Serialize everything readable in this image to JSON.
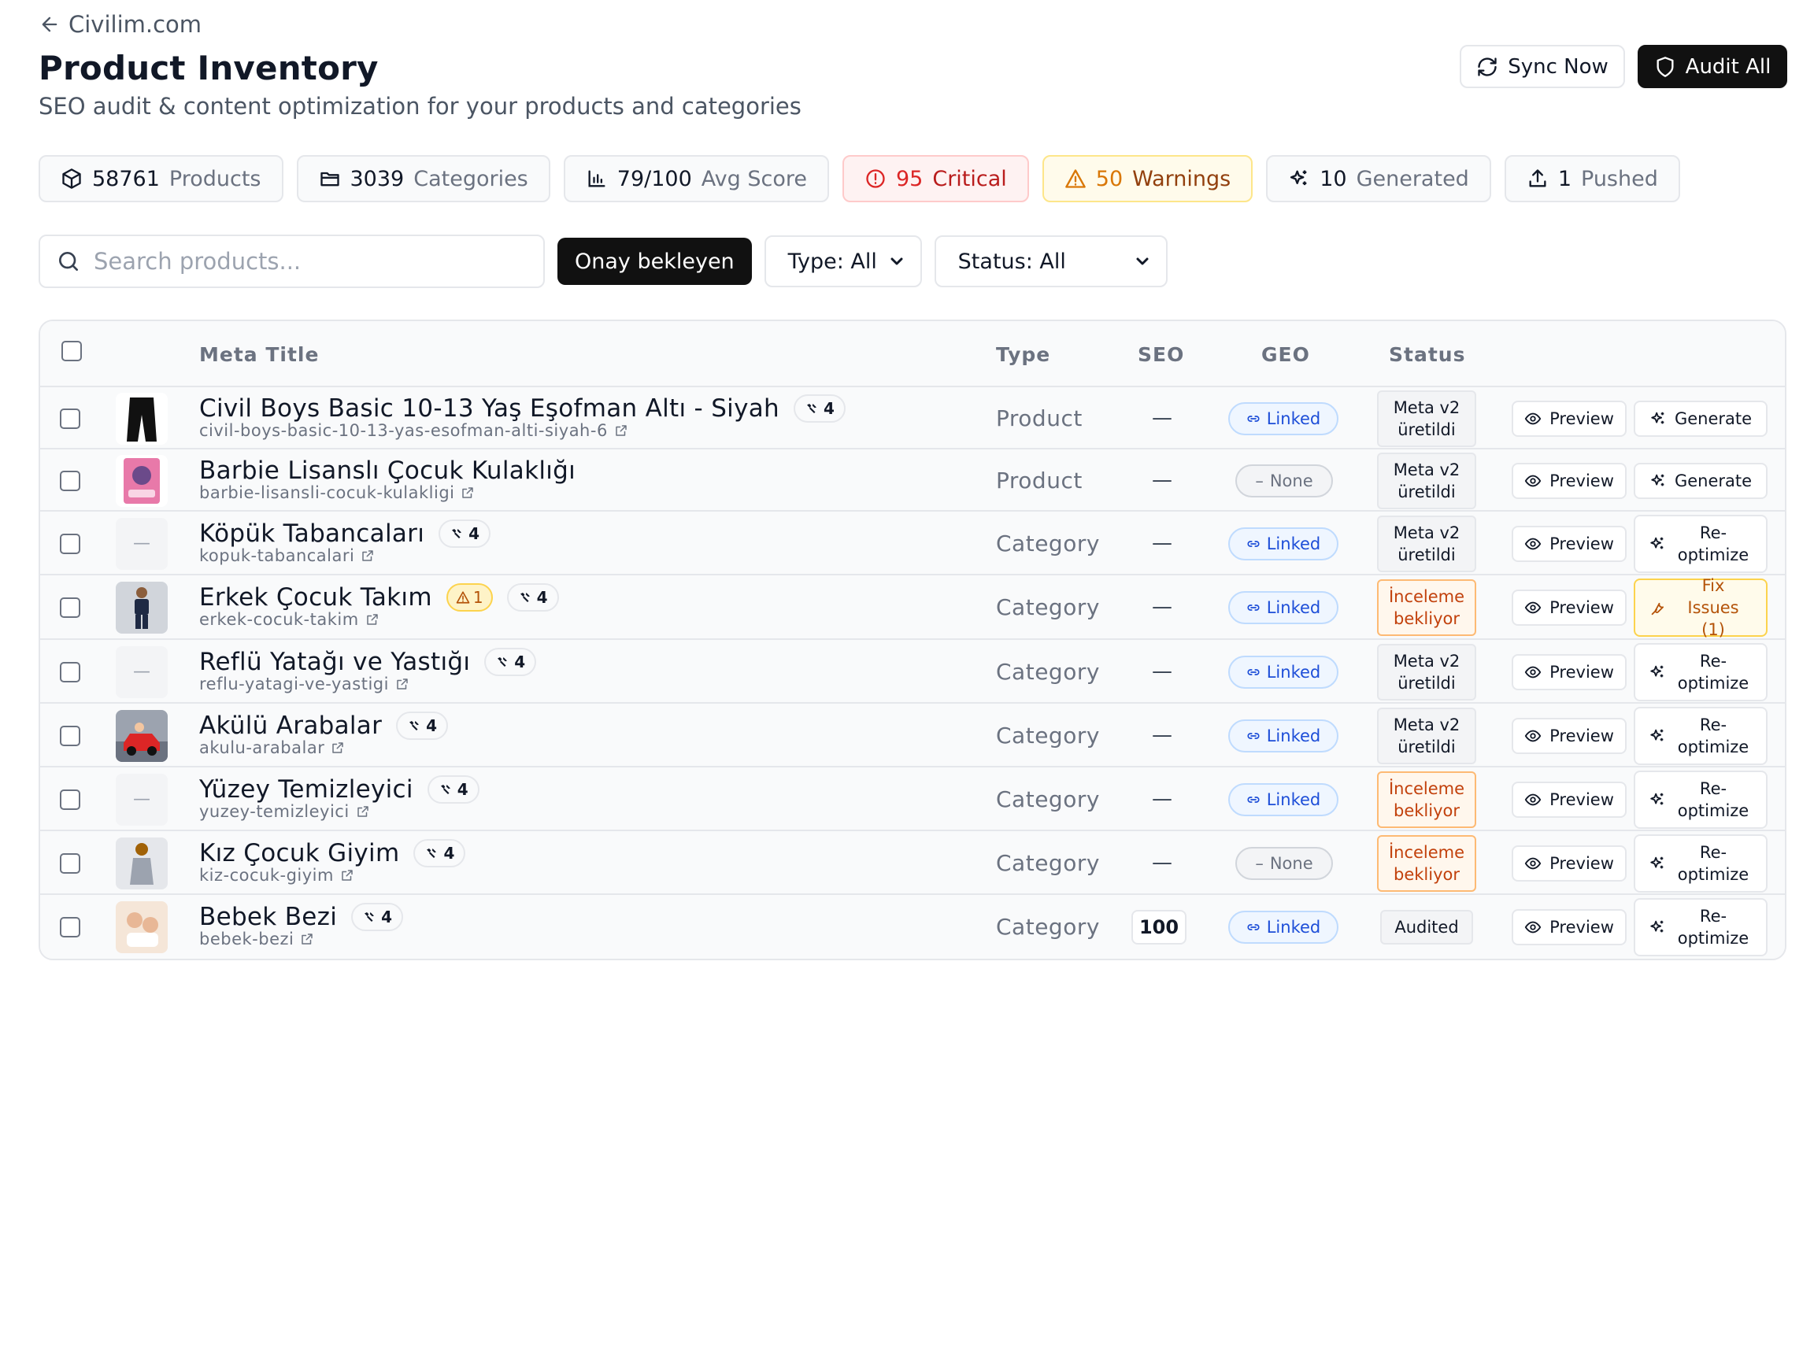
{
  "header": {
    "back_label": "Civilim.com",
    "title": "Product Inventory",
    "subtitle": "SEO audit & content optimization for your products and categories",
    "sync_label": "Sync Now",
    "audit_label": "Audit All"
  },
  "stats": [
    {
      "num": "58761",
      "label": "Products",
      "icon": "cube-icon"
    },
    {
      "num": "3039",
      "label": "Categories",
      "icon": "folder-icon"
    },
    {
      "num": "79/100",
      "label": "Avg Score",
      "icon": "bar-chart-icon"
    },
    {
      "num": "95",
      "label": "Critical",
      "icon": "alert-circle-icon"
    },
    {
      "num": "50",
      "label": "Warnings",
      "icon": "warning-triangle-icon"
    },
    {
      "num": "10",
      "label": "Generated",
      "icon": "sparkles-icon"
    },
    {
      "num": "1",
      "label": "Pushed",
      "icon": "upload-icon"
    }
  ],
  "filters": {
    "search_placeholder": "Search products...",
    "pending_label": "Onay bekleyen",
    "type_select": "Type: All",
    "status_select": "Status: All"
  },
  "table": {
    "columns": [
      "Meta Title",
      "Type",
      "SEO",
      "GEO",
      "Status"
    ],
    "preview_label": "Preview",
    "rows": [
      {
        "name": "Civil Boys Basic 10-13 Yaş Eşofman Altı - Siyah",
        "slug": "civil-boys-basic-10-13-yas-esofman-alti-siyah-6",
        "count": "4",
        "warn": "",
        "type": "Product",
        "seo": "—",
        "geo": "Linked",
        "status1": "Meta v2",
        "status2": "üretildi",
        "action1": "Generate",
        "action2": "",
        "thumb": "pants"
      },
      {
        "name": "Barbie Lisanslı Çocuk Kulaklığı",
        "slug": "barbie-lisansli-cocuk-kulakligi",
        "count": "",
        "warn": "",
        "type": "Product",
        "seo": "—",
        "geo": "None",
        "status1": "Meta v2",
        "status2": "üretildi",
        "action1": "Generate",
        "action2": "",
        "thumb": "box"
      },
      {
        "name": "Köpük Tabancaları",
        "slug": "kopuk-tabancalari",
        "count": "4",
        "warn": "",
        "type": "Category",
        "seo": "—",
        "geo": "Linked",
        "status1": "Meta v2",
        "status2": "üretildi",
        "action1": "Re-",
        "action2": "optimize",
        "thumb": "none"
      },
      {
        "name": "Erkek Çocuk Takım",
        "slug": "erkek-cocuk-takim",
        "count": "4",
        "warn": "1",
        "type": "Category",
        "seo": "—",
        "geo": "Linked",
        "status1": "İnceleme",
        "status2": "bekliyor",
        "action1": "Fix Issues",
        "action2": "(1)",
        "thumb": "boy"
      },
      {
        "name": "Reflü Yatağı ve Yastığı",
        "slug": "reflu-yatagi-ve-yastigi",
        "count": "4",
        "warn": "",
        "type": "Category",
        "seo": "—",
        "geo": "Linked",
        "status1": "Meta v2",
        "status2": "üretildi",
        "action1": "Re-",
        "action2": "optimize",
        "thumb": "none"
      },
      {
        "name": "Akülü Arabalar",
        "slug": "akulu-arabalar",
        "count": "4",
        "warn": "",
        "type": "Category",
        "seo": "—",
        "geo": "Linked",
        "status1": "Meta v2",
        "status2": "üretildi",
        "action1": "Re-",
        "action2": "optimize",
        "thumb": "car"
      },
      {
        "name": "Yüzey Temizleyici",
        "slug": "yuzey-temizleyici",
        "count": "4",
        "warn": "",
        "type": "Category",
        "seo": "—",
        "geo": "Linked",
        "status1": "İnceleme",
        "status2": "bekliyor",
        "action1": "Re-",
        "action2": "optimize",
        "thumb": "none"
      },
      {
        "name": "Kız Çocuk Giyim",
        "slug": "kiz-cocuk-giyim",
        "count": "4",
        "warn": "",
        "type": "Category",
        "seo": "—",
        "geo": "None",
        "status1": "İnceleme",
        "status2": "bekliyor",
        "action1": "Re-",
        "action2": "optimize",
        "thumb": "girl"
      },
      {
        "name": "Bebek Bezi",
        "slug": "bebek-bezi",
        "count": "4",
        "warn": "",
        "type": "Category",
        "seo": "100",
        "geo": "Linked",
        "status1": "Audited",
        "status2": "",
        "action1": "Re-",
        "action2": "optimize",
        "thumb": "baby"
      }
    ]
  },
  "colors": {
    "dark_button": "#111111",
    "critical": "#dc2626",
    "warning": "#d97706",
    "linked": "#1d4ed8",
    "review": "#c2410c"
  }
}
